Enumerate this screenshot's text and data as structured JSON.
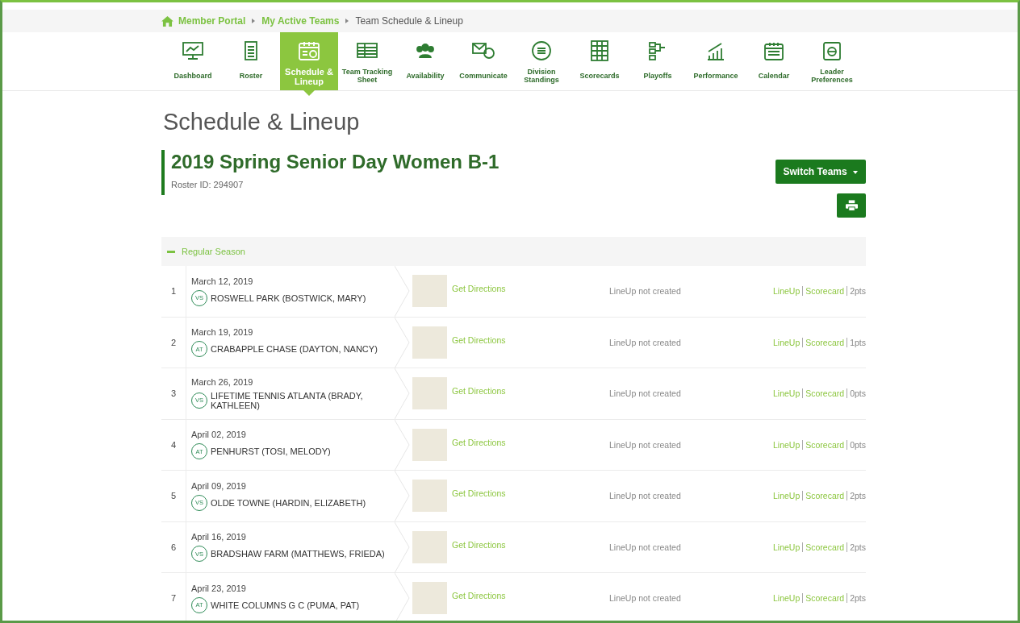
{
  "breadcrumb": [
    {
      "label": "Member Portal",
      "kind": "home"
    },
    {
      "label": "My Active Teams",
      "kind": "link"
    },
    {
      "label": "Team Schedule & Lineup",
      "kind": "current"
    }
  ],
  "nav": [
    {
      "label": "Dashboard",
      "selected": false
    },
    {
      "label": "Roster",
      "selected": false
    },
    {
      "label": "Schedule & Lineup",
      "selected": true
    },
    {
      "label": "Team Tracking Sheet",
      "selected": false
    },
    {
      "label": "Availability",
      "selected": false
    },
    {
      "label": "Communicate",
      "selected": false
    },
    {
      "label": "Division Standings",
      "selected": false
    },
    {
      "label": "Scorecards",
      "selected": false
    },
    {
      "label": "Playoffs",
      "selected": false
    },
    {
      "label": "Performance",
      "selected": false
    },
    {
      "label": "Calendar",
      "selected": false
    },
    {
      "label": "Leader Preferences",
      "selected": false
    }
  ],
  "page_title": "Schedule & Lineup",
  "team": {
    "name": "2019 Spring Senior Day Women B-1",
    "roster_id": "Roster ID: 294907"
  },
  "switch_button": "Switch Teams",
  "section": {
    "title": "Regular Season",
    "expanded": true
  },
  "matches": [
    {
      "number": "1",
      "date": "March 12, 2019",
      "venue": "VS",
      "opponent": "ROSWELL PARK (BOSTWICK, MARY)",
      "directions": "Get Directions",
      "lineup_status": "LineUp not created",
      "lineup": "LineUp",
      "scorecard": "Scorecard",
      "points": "2pts"
    },
    {
      "number": "2",
      "date": "March 19, 2019",
      "venue": "AT",
      "opponent": "CRABAPPLE CHASE (DAYTON, NANCY)",
      "directions": "Get Directions",
      "lineup_status": "LineUp not created",
      "lineup": "LineUp",
      "scorecard": "Scorecard",
      "points": "1pts"
    },
    {
      "number": "3",
      "date": "March 26, 2019",
      "venue": "VS",
      "opponent": "LIFETIME TENNIS ATLANTA (BRADY, KATHLEEN)",
      "directions": "Get Directions",
      "lineup_status": "LineUp not created",
      "lineup": "LineUp",
      "scorecard": "Scorecard",
      "points": "0pts"
    },
    {
      "number": "4",
      "date": "April 02, 2019",
      "venue": "AT",
      "opponent": "PENHURST (TOSI, MELODY)",
      "directions": "Get Directions",
      "lineup_status": "LineUp not created",
      "lineup": "LineUp",
      "scorecard": "Scorecard",
      "points": "0pts"
    },
    {
      "number": "5",
      "date": "April 09, 2019",
      "venue": "VS",
      "opponent": "OLDE TOWNE (HARDIN, ELIZABETH)",
      "directions": "Get Directions",
      "lineup_status": "LineUp not created",
      "lineup": "LineUp",
      "scorecard": "Scorecard",
      "points": "2pts"
    },
    {
      "number": "6",
      "date": "April 16, 2019",
      "venue": "VS",
      "opponent": "BRADSHAW FARM (MATTHEWS, FRIEDA)",
      "directions": "Get Directions",
      "lineup_status": "LineUp not created",
      "lineup": "LineUp",
      "scorecard": "Scorecard",
      "points": "2pts"
    },
    {
      "number": "7",
      "date": "April 23, 2019",
      "venue": "AT",
      "opponent": "WHITE COLUMNS G C (PUMA, PAT)",
      "directions": "Get Directions",
      "lineup_status": "LineUp not created",
      "lineup": "LineUp",
      "scorecard": "Scorecard",
      "points": "2pts"
    }
  ]
}
